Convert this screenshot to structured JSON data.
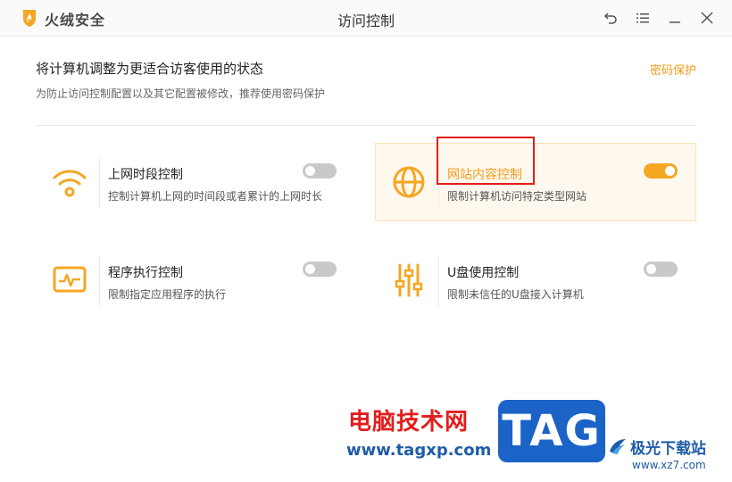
{
  "app": {
    "brand": "火绒安全",
    "window_title": "访问控制"
  },
  "header": {
    "title": "将计算机调整为更适合访客使用的状态",
    "subtitle": "为防止访问控制配置以及其它配置被修改，推荐使用密码保护",
    "password_link": "密码保护"
  },
  "cards": [
    {
      "name": "上网时段控制",
      "desc": "控制计算机上网的时间段或者累计的上网时长",
      "icon": "wifi-icon",
      "enabled": false,
      "active": false
    },
    {
      "name": "网站内容控制",
      "desc": "限制计算机访问特定类型网站",
      "icon": "globe-icon",
      "enabled": true,
      "active": true
    },
    {
      "name": "程序执行控制",
      "desc": "限制指定应用程序的执行",
      "icon": "monitor-pulse-icon",
      "enabled": false,
      "active": false
    },
    {
      "name": "U盘使用控制",
      "desc": "限制未信任的U盘接入计算机",
      "icon": "sliders-icon",
      "enabled": false,
      "active": false
    }
  ],
  "watermark": {
    "site_cn": "电脑技术网",
    "site_url": "www.tagxp.com",
    "tag": "TAG",
    "partner_cn": "极光下载站",
    "partner_url": "www.xz7.com"
  },
  "colors": {
    "accent": "#f39c1b",
    "toggle_on": "#f5a623",
    "toggle_off": "#c9c9c9",
    "highlight": "#e0201b"
  }
}
